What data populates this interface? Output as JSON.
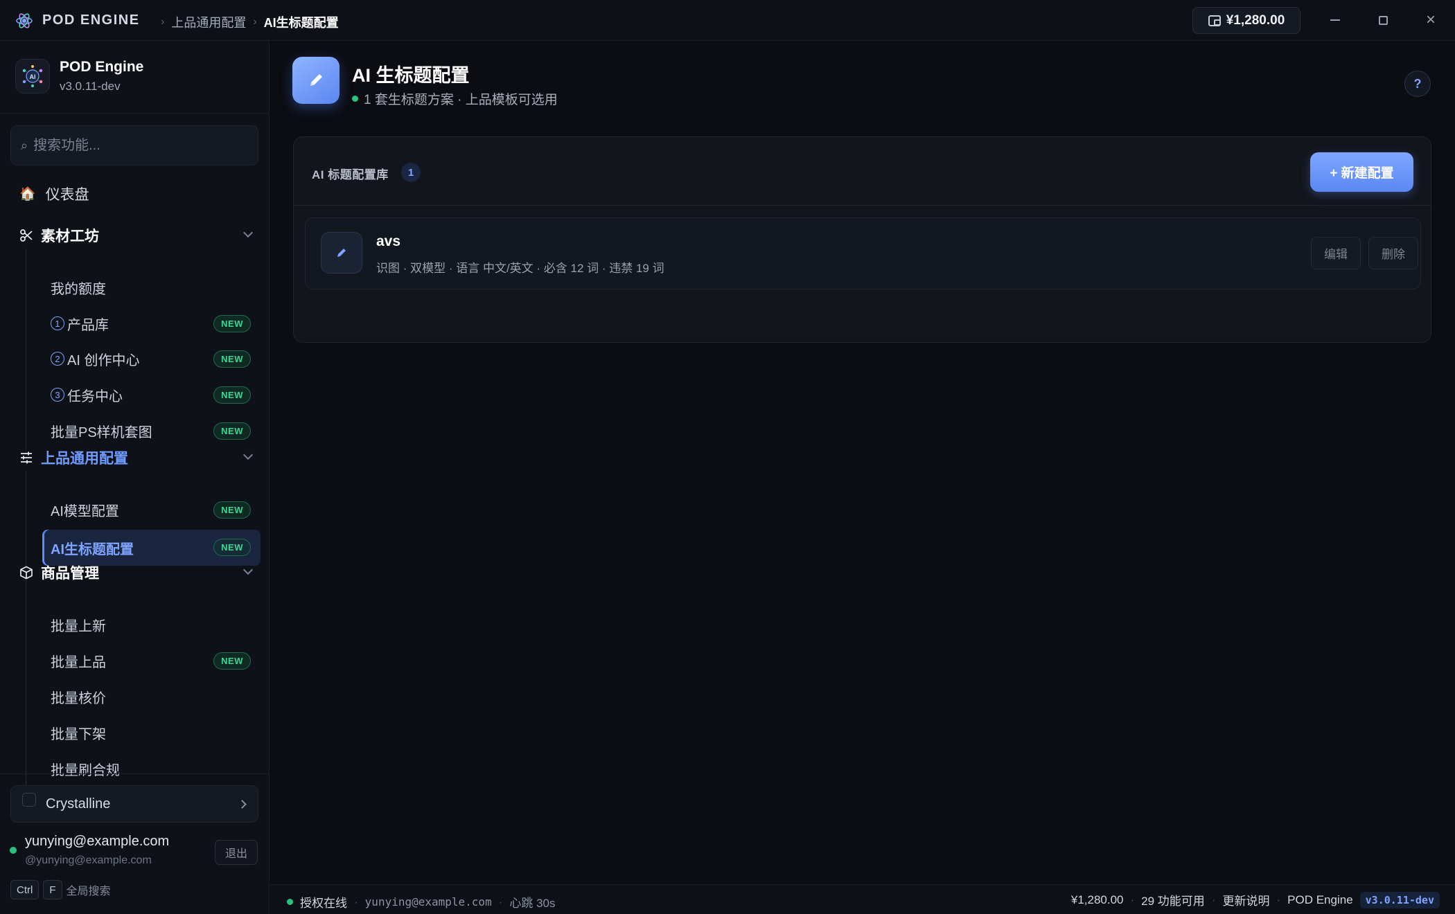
{
  "titlebar": {
    "app_name": "POD ENGINE",
    "breadcrumbs": [
      "上品通用配置",
      "AI生标题配置"
    ],
    "wallet": "¥1,280.00",
    "logo_icon": "atom-logo-icon"
  },
  "sidebar": {
    "brand_name": "POD Engine",
    "brand_version": "v3.0.11-dev",
    "search_placeholder": "搜索功能...",
    "dashboard": {
      "label": "仪表盘",
      "icon": "house-icon"
    },
    "groups": [
      {
        "label": "素材工坊",
        "icon": "scissors-icon",
        "items": [
          {
            "label": "我的额度",
            "badge": ""
          },
          {
            "num": "1",
            "label": "产品库",
            "badge": "NEW"
          },
          {
            "num": "2",
            "label": "AI 创作中心",
            "badge": "NEW"
          },
          {
            "num": "3",
            "label": "任务中心",
            "badge": "NEW"
          },
          {
            "label": "批量PS样机套图",
            "badge": "NEW"
          }
        ]
      },
      {
        "label": "上品通用配置",
        "icon": "sliders-icon",
        "active": true,
        "items": [
          {
            "label": "AI模型配置",
            "badge": "NEW"
          },
          {
            "label": "AI生标题配置",
            "badge": "NEW",
            "active": true
          }
        ]
      },
      {
        "label": "商品管理",
        "icon": "box-icon",
        "items": [
          {
            "label": "批量上新",
            "badge": ""
          },
          {
            "label": "批量上品",
            "badge": "NEW"
          },
          {
            "label": "批量核价",
            "badge": ""
          },
          {
            "label": "批量下架",
            "badge": ""
          },
          {
            "label": "批量刷合规",
            "badge": ""
          }
        ]
      }
    ],
    "theme": "Crystalline",
    "user_email": "yunying@example.com",
    "user_handle": "@yunying@example.com",
    "logout_label": "退出",
    "shortcut_keys": [
      "Ctrl",
      "F"
    ],
    "shortcut_label": "全局搜索"
  },
  "main": {
    "title": "AI 生标题配置",
    "subtitle": "1 套生标题方案 · 上品模板可选用",
    "help": "?",
    "panel_title": "AI 标题配置库",
    "count": "1",
    "new_button": "+ 新建配置",
    "configs": [
      {
        "name": "avs",
        "desc": "识图 · 双模型 · 语言 中文/英文 · 必含 12 词 · 违禁 19 词",
        "edit_label": "编辑",
        "delete_label": "删除",
        "icon": "pencil-icon"
      }
    ]
  },
  "statusbar": {
    "online": "授权在线",
    "user": "yunying@example.com",
    "heartbeat": "心跳 30s",
    "balance": "¥1,280.00",
    "features": "29 功能可用",
    "changelog": "更新说明",
    "app": "POD Engine",
    "version": "v3.0.11-dev"
  },
  "colors": {
    "accent": "#6f9bff",
    "success": "#27c47f",
    "new_badge": "#3ed597",
    "background": "#0b0d12"
  }
}
